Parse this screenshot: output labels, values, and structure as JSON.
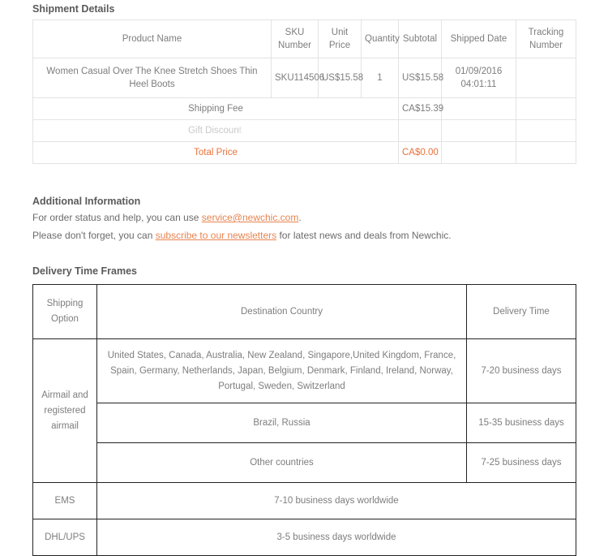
{
  "shipment": {
    "title": "Shipment Details",
    "columns": [
      "Product Name",
      "SKU Number",
      "Unit Price",
      "Quantity",
      "Subtotal",
      "Shipped Date",
      "Tracking Number"
    ],
    "column_labels": {
      "product": "Product Name",
      "sku_line1": "SKU",
      "sku_line2": "Number",
      "unit_price": "Unit Price",
      "quantity": "Quantity",
      "subtotal": "Subtotal",
      "shipped_date": "Shipped Date",
      "tracking_line1": "Tracking",
      "tracking_line2": "Number"
    },
    "items": [
      {
        "product_name": "Women Casual Over The Knee Stretch Shoes Thin Heel Boots",
        "sku": "SKU114506",
        "unit_price": "US$15.58",
        "quantity": "1",
        "subtotal": "US$15.58",
        "shipped_date_line1": "01/09/2016",
        "shipped_date_line2": "04:01:11",
        "tracking_number": ""
      }
    ],
    "summary": [
      {
        "label": "Shipping Fee",
        "value": "CA$15.39"
      },
      {
        "label": "Gift Discoun",
        "label_tail": "t",
        "value": ""
      },
      {
        "label": "Total Price",
        "value": "CA$0.00"
      }
    ]
  },
  "additional_information": {
    "title": "Additional Information",
    "line1_prefix": "For order status and help, you can use ",
    "line1_link": "service@newchic.com",
    "line1_suffix": ".",
    "line2_prefix": "Please don't forget, you can ",
    "line2_link": "subscribe to our newsletters",
    "line2_suffix": " for latest news and deals from Newchic."
  },
  "delivery": {
    "title": "Delivery Time Frames",
    "headers": {
      "option_line1": "Shipping",
      "option_line2": "Option",
      "destination": "Destination Country",
      "time": "Delivery Time"
    },
    "rows": [
      {
        "option_line1": "Airmail and",
        "option_line2": "registered",
        "option_line3": "airmail",
        "destination": "United States, Canada, Australia, New Zealand, Singapore,United Kingdom, France, Spain, Germany, Netherlands, Japan, Belgium, Denmark, Finland, Ireland, Norway, Portugal, Sweden, Switzerland",
        "time": "7-20 business days"
      },
      {
        "destination": "Brazil, Russia",
        "time": "15-35 business days"
      },
      {
        "destination": "Other countries",
        "time": "7-25 business days"
      },
      {
        "option": "EMS",
        "destination": "7-10 business days worldwide"
      },
      {
        "option": "DHL/UPS",
        "destination": "3-5 business days worldwide"
      }
    ]
  },
  "colors": {
    "accent": "#e8713c",
    "link": "#e8834f",
    "text": "#6b6b6b",
    "table_border_light": "#e3e3e3",
    "table_border_dark": "#222222"
  }
}
